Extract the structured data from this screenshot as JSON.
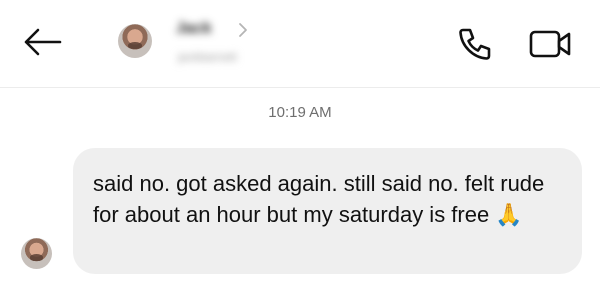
{
  "header": {
    "contact_name": "Jack",
    "contact_handle": "jackbarnett",
    "back_icon": "arrow-left-icon",
    "call_icon": "phone-icon",
    "video_icon": "video-camera-icon"
  },
  "conversation": {
    "timestamp": "10:19 AM",
    "messages": [
      {
        "sender": "contact",
        "text": "said no. got asked again. still said no. felt rude for about an hour but my saturday is free 🙏"
      }
    ]
  },
  "colors": {
    "bubble_background": "#efefef",
    "divider": "#ececec",
    "timestamp_text": "#6e6e6e"
  }
}
